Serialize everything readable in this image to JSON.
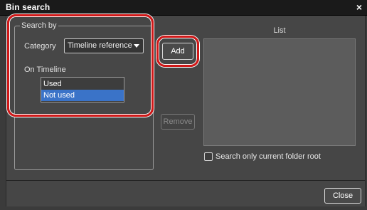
{
  "window": {
    "title": "Bin search",
    "close_glyph": "×",
    "close_icon": "close-icon"
  },
  "search_by": {
    "legend": "Search by",
    "category_label": "Category",
    "category_value": "Timeline reference",
    "category_icon": "chevron-down-icon",
    "on_timeline_label": "On Timeline",
    "options": [
      "Used",
      "Not used"
    ],
    "selected": "Not used"
  },
  "buttons": {
    "add": "Add",
    "remove": "Remove",
    "close": "Close"
  },
  "list": {
    "header": "List",
    "items": []
  },
  "folder_option": {
    "label": "Search only current folder root",
    "checked": false
  },
  "colors": {
    "highlight_ring": "#d01818",
    "selection": "#3a73c8"
  }
}
